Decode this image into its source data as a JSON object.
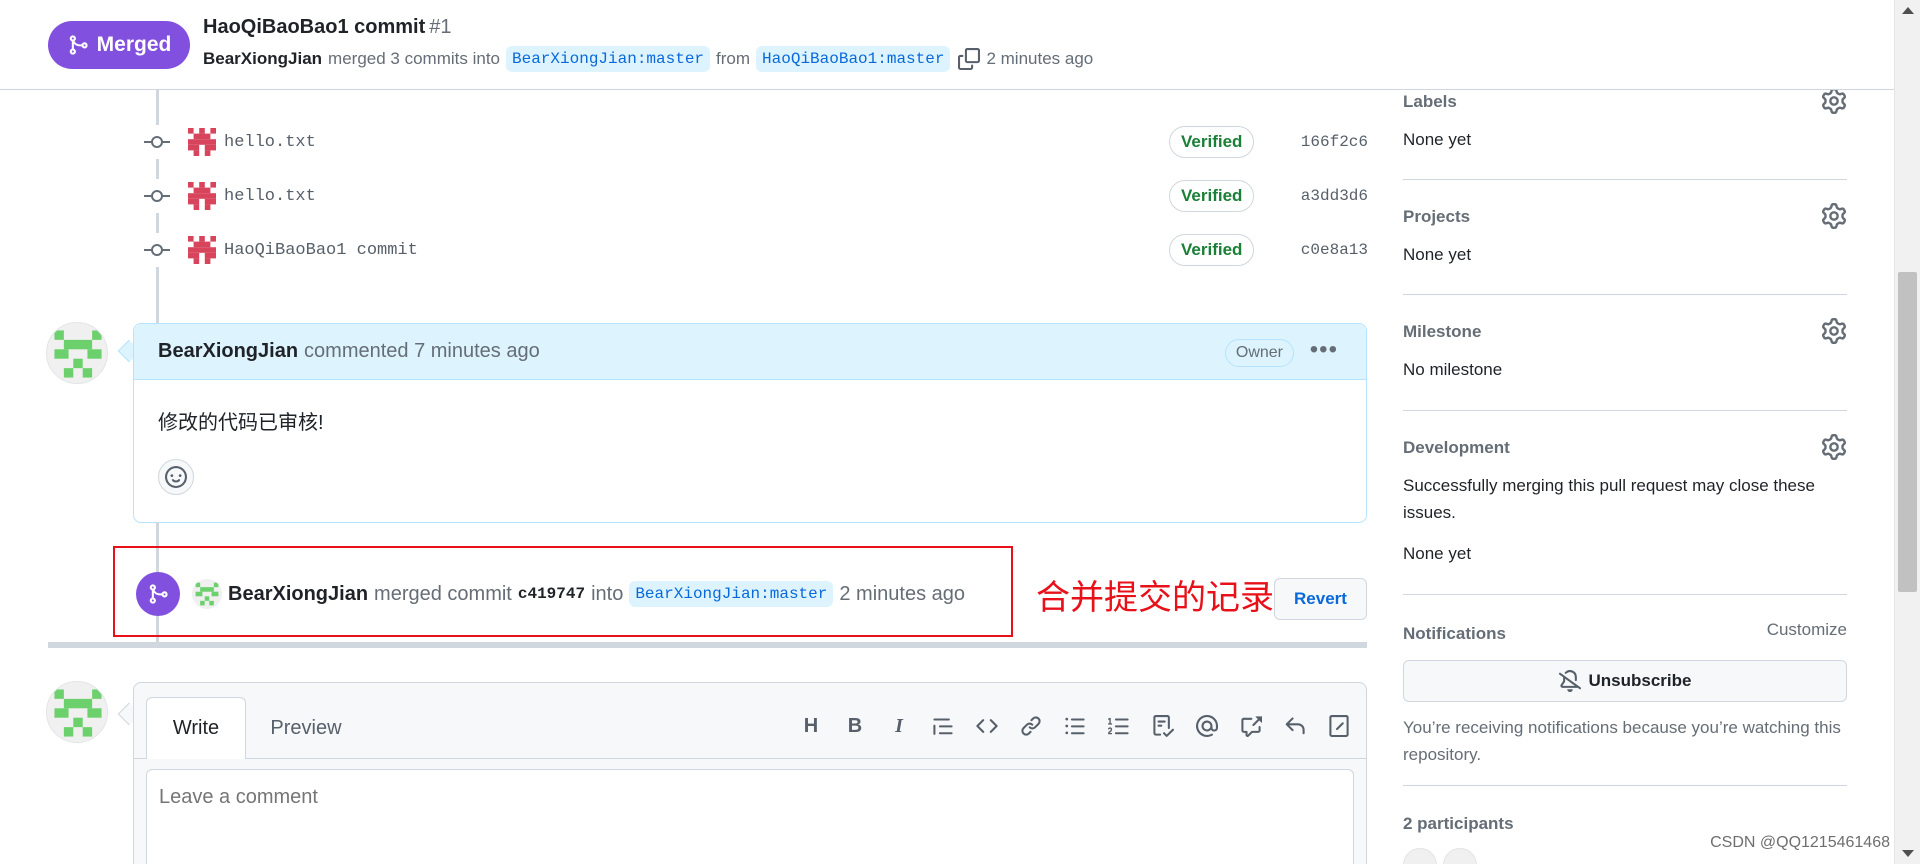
{
  "header": {
    "status_badge": "Merged",
    "title": "HaoQiBaoBao1 commit",
    "number": "#1",
    "author": "BearXiongJian",
    "merged_text": "merged 3 commits into",
    "base_branch": "BearXiongJian:master",
    "from_text": "from",
    "head_branch": "HaoQiBaoBao1:master",
    "time": "2 minutes ago"
  },
  "commits": [
    {
      "message": "hello.txt",
      "badge": "Verified",
      "sha": "166f2c6"
    },
    {
      "message": "hello.txt",
      "badge": "Verified",
      "sha": "a3dd3d6"
    },
    {
      "message": "HaoQiBaoBao1 commit",
      "badge": "Verified",
      "sha": "c0e8a13"
    }
  ],
  "comment": {
    "author": "BearXiongJian",
    "action": "commented 7 minutes ago",
    "role_badge": "Owner",
    "body": "修改的代码已审核!"
  },
  "merge_event": {
    "author": "BearXiongJian",
    "text1": "merged commit",
    "sha": "c419747",
    "text2": "into",
    "branch": "BearXiongJian:master",
    "time": "2 minutes ago",
    "revert_label": "Revert"
  },
  "annotation": "合并提交的记录",
  "editor": {
    "tab_write": "Write",
    "tab_preview": "Preview",
    "toolbar_heading": "H",
    "toolbar_bold": "B",
    "toolbar_italic": "I",
    "placeholder": "Leave a comment"
  },
  "sidebar": {
    "labels_title": "Labels",
    "labels_value": "None yet",
    "projects_title": "Projects",
    "projects_value": "None yet",
    "milestone_title": "Milestone",
    "milestone_value": "No milestone",
    "development_title": "Development",
    "development_text": "Successfully merging this pull request may close these issues.",
    "development_value": "None yet",
    "notifications_title": "Notifications",
    "customize_label": "Customize",
    "unsubscribe_label": "Unsubscribe",
    "notifications_note": "You’re receiving notifications because you’re watching this repository.",
    "participants_title": "2 participants"
  },
  "watermark": "CSDN @QQ1215461468",
  "colors": {
    "merged_purple": "#8250df",
    "verified_green": "#1a7f37",
    "link_blue": "#0969da",
    "annotation_red": "#e8111a"
  }
}
